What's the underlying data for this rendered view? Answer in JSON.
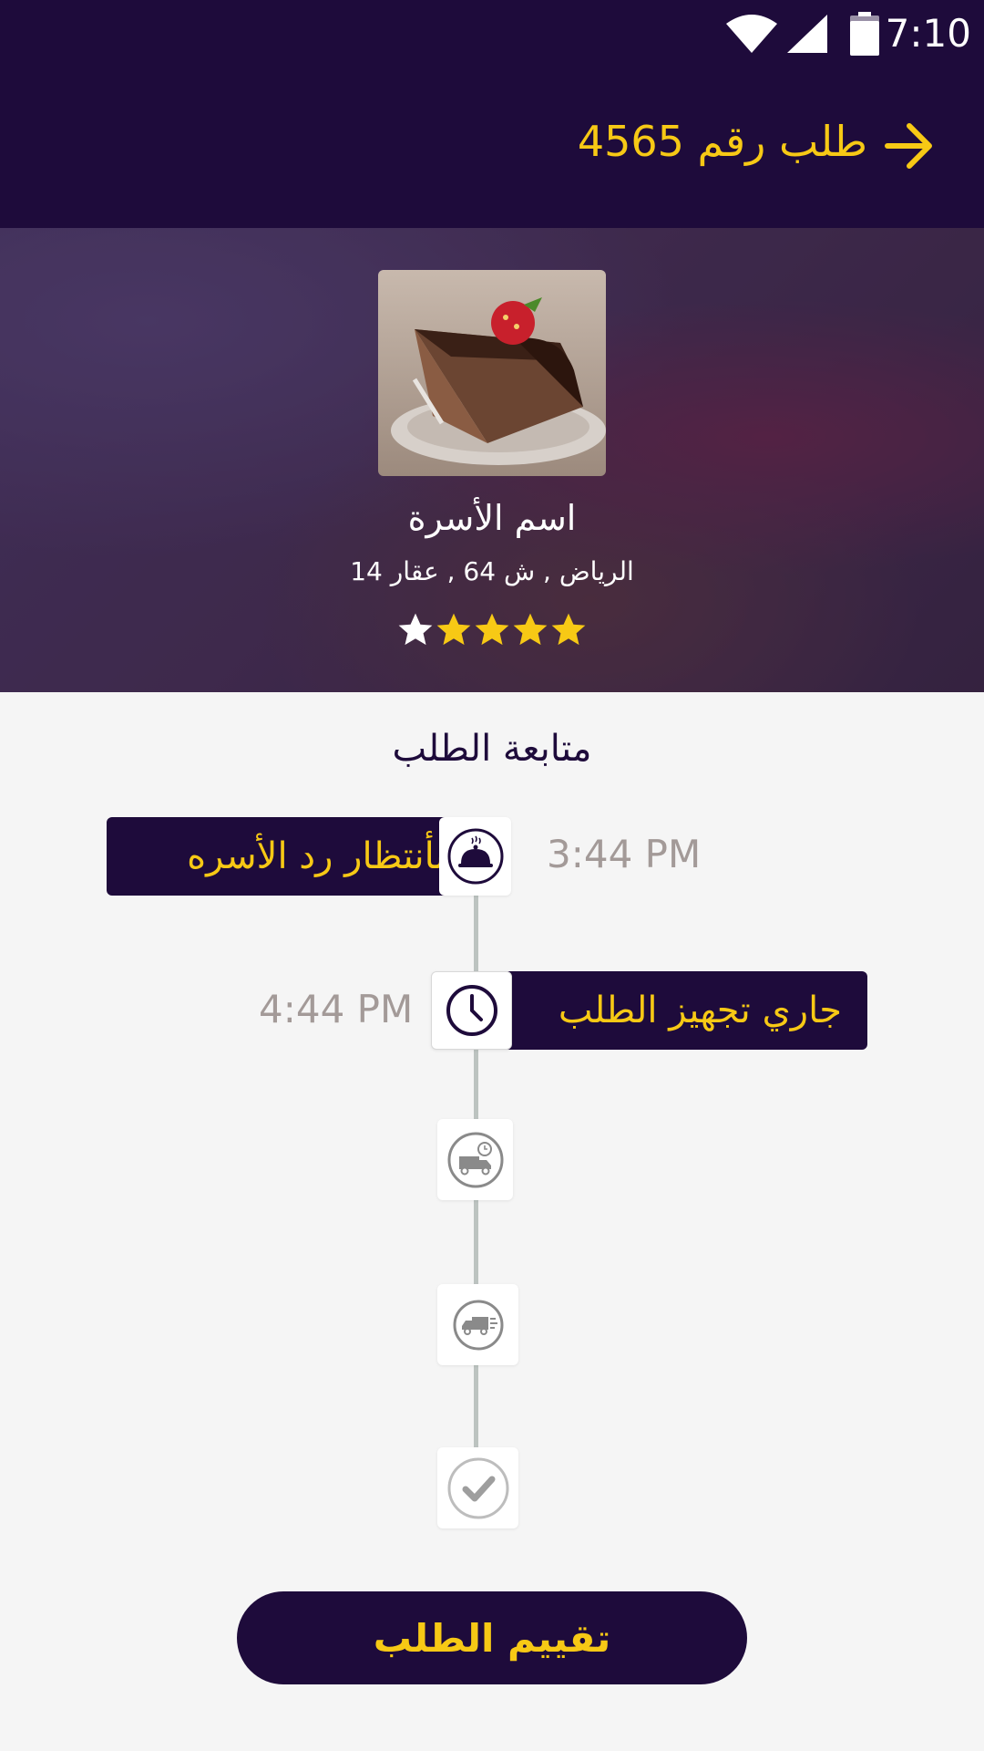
{
  "status_bar": {
    "time": "7:10",
    "icons": [
      "wifi-icon",
      "cell-signal-icon",
      "battery-icon"
    ]
  },
  "header": {
    "title": "طلب رقم 4565",
    "back_icon": "arrow-right-icon"
  },
  "store": {
    "family_name": "اسم الأسرة",
    "address": "الرياض , ش 64 , عقار 14",
    "rating": 4,
    "rating_max": 5,
    "product_image": "chocolate-cake-slice"
  },
  "tracking": {
    "title": "متابعة الطلب",
    "steps": [
      {
        "label": "بأنتظار رد الأسره",
        "time": "3:44 PM",
        "icon": "food-dome-icon",
        "status": "done"
      },
      {
        "label": "جاري تجهيز الطلب",
        "time": "4:44 PM",
        "icon": "clock-icon",
        "status": "current"
      },
      {
        "icon": "delivery-truck-clock-icon",
        "status": "pending"
      },
      {
        "icon": "delivery-truck-moving-icon",
        "status": "pending"
      },
      {
        "icon": "check-icon",
        "status": "pending"
      }
    ]
  },
  "actions": {
    "rate_order_label": "تقييم الطلب"
  },
  "colors": {
    "primary": "#1e0b3b",
    "accent": "#f7c915",
    "background": "#f5f5f5",
    "muted_text": "#a39a98",
    "star_empty": "#ffffff"
  }
}
